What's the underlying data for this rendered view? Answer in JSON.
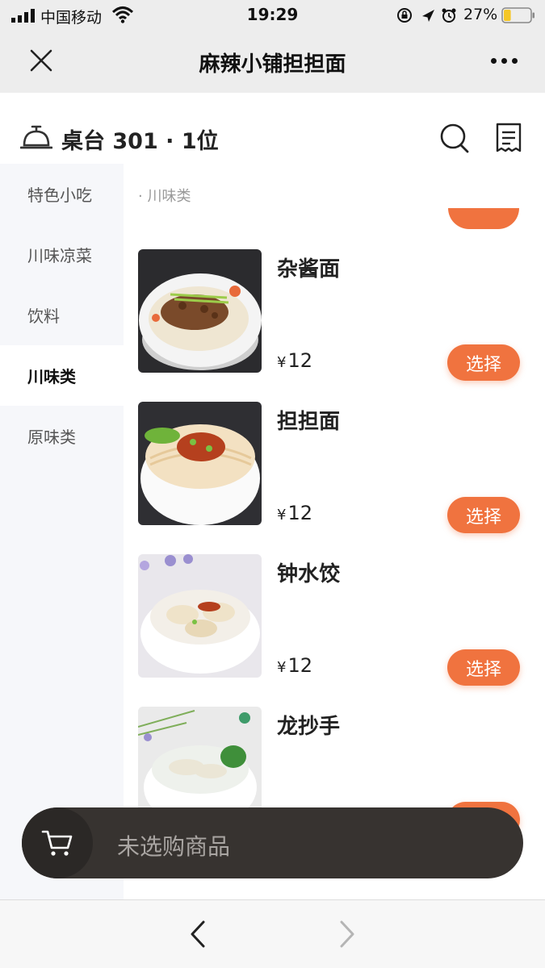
{
  "status_bar": {
    "carrier": "中国移动",
    "time": "19:29",
    "battery_percent": "27%",
    "battery_level": 0.27
  },
  "nav": {
    "title": "麻辣小铺担担面",
    "icons": {
      "close": "close-icon",
      "more": "more-icon"
    }
  },
  "table": {
    "info": "桌台 301 · 1位",
    "icons": {
      "bell": "service-bell-icon",
      "search": "search-icon",
      "orders": "receipt-icon"
    }
  },
  "sidebar": {
    "items": [
      {
        "label": "特色小吃",
        "active": false
      },
      {
        "label": "川味凉菜",
        "active": false
      },
      {
        "label": "饮料",
        "active": false
      },
      {
        "label": "川味类",
        "active": true
      },
      {
        "label": "原味类",
        "active": false
      }
    ]
  },
  "menu": {
    "section_label": "· 川味类",
    "select_label": "选择",
    "currency": "¥",
    "dishes": [
      {
        "name": "杂酱面",
        "price": "12"
      },
      {
        "name": "担担面",
        "price": "12"
      },
      {
        "name": "钟水饺",
        "price": "12"
      },
      {
        "name": "龙抄手",
        "price": ""
      }
    ]
  },
  "cart": {
    "empty_text": "未选购商品",
    "icon": "cart-icon"
  },
  "colors": {
    "accent": "#f0733f",
    "cart_bar": "#373330",
    "sidebar_bg": "#f6f7fa",
    "chrome_bg": "#ededed"
  }
}
